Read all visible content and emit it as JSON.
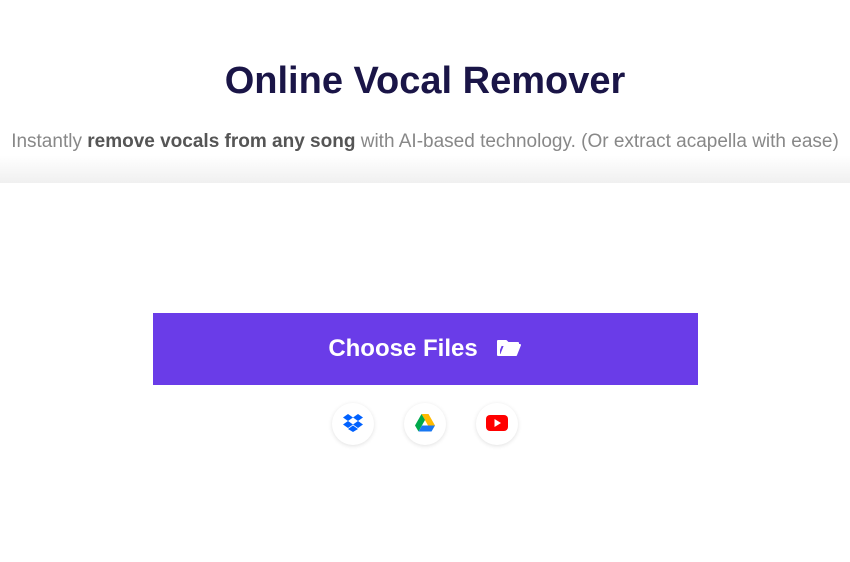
{
  "header": {
    "title": "Online Vocal Remover",
    "subtitle_prefix": "Instantly ",
    "subtitle_bold": "remove vocals from any song",
    "subtitle_suffix": " with AI-based technology. (Or extract acapella with ease)"
  },
  "main": {
    "choose_files_label": "Choose Files"
  },
  "sources": {
    "dropbox": "dropbox",
    "google_drive": "google-drive",
    "youtube": "youtube"
  }
}
